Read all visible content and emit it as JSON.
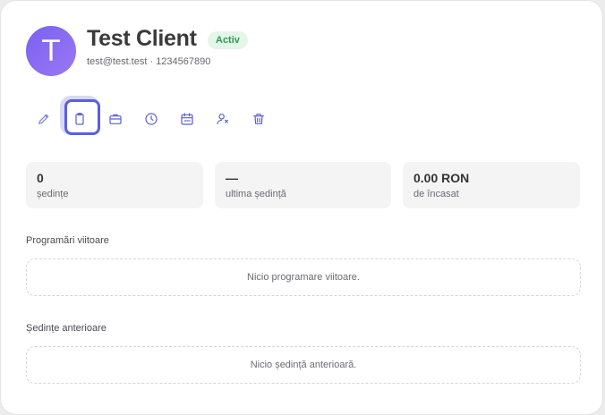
{
  "client": {
    "initial": "T",
    "name": "Test Client",
    "status": "Activ",
    "contact": "test@test.test · 1234567890"
  },
  "toolbar": [
    {
      "icon": "pencil-icon",
      "label": "edit"
    },
    {
      "icon": "clipboard-icon",
      "label": "notes"
    },
    {
      "icon": "briefcase-icon",
      "label": "work"
    },
    {
      "icon": "clock-icon",
      "label": "history"
    },
    {
      "icon": "calendar-icon",
      "label": "schedule"
    },
    {
      "icon": "user-icon",
      "label": "client"
    },
    {
      "icon": "trash-icon",
      "label": "delete"
    }
  ],
  "stats": [
    {
      "value": "0",
      "label": "ședințe"
    },
    {
      "value": "—",
      "label": "ultima ședință"
    },
    {
      "value": "0.00 RON",
      "label": "de încasat"
    }
  ],
  "upcoming": {
    "title": "Programări viitoare",
    "empty": "Nicio programare viitoare."
  },
  "past": {
    "title": "Ședințe anterioare",
    "empty": "Nicio ședință anterioară."
  },
  "colors": {
    "accent": "#5b5ee0",
    "avatar": "#8a6cf3",
    "badge_bg": "#e3f6e8",
    "badge_text": "#2f9a4f"
  }
}
